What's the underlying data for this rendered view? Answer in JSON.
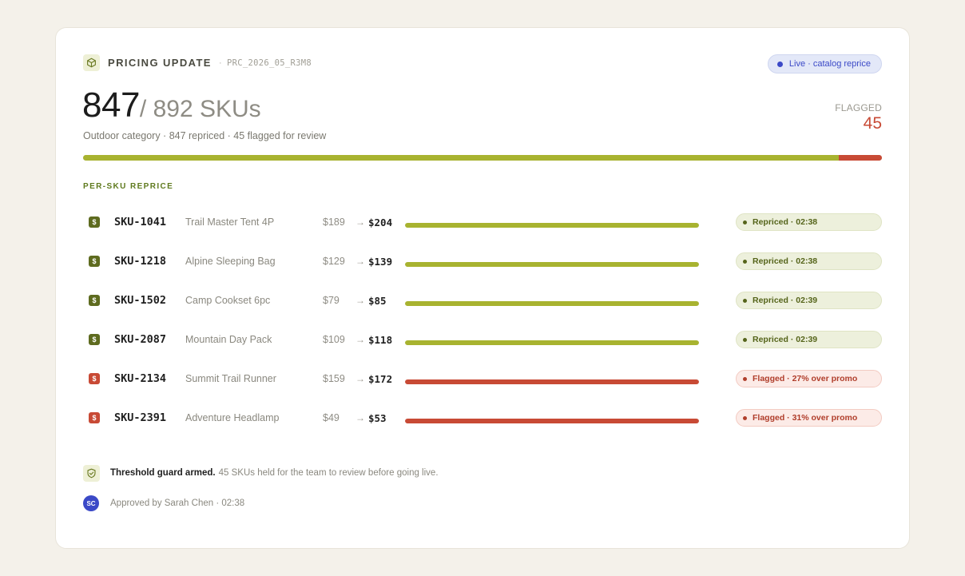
{
  "header": {
    "title": "PRICING UPDATE",
    "separator": "·",
    "run_code": "PRC_2026_05_R3M8",
    "live_label": "Live · catalog reprice"
  },
  "summary": {
    "repriced_count": "847",
    "total_label": "/ 892 SKUs",
    "subtitle": "Outdoor category · 847 repriced · 45 flagged for review",
    "flagged_label": "FLAGGED",
    "flagged_value": "45",
    "progress_repriced_fraction": 0.946
  },
  "section_title": "PER-SKU REPRICE",
  "colors": {
    "ok": "#a8b330",
    "flagged": "#c84a35",
    "live": "#3b49c7"
  },
  "rows": [
    {
      "sku": "SKU-1041",
      "name": "Trail Master Tent 4P",
      "old_price": "$189",
      "arrow": "→",
      "new_price": "$204",
      "status": "Repriced · 02:38",
      "state": "ok",
      "icon": "dollar-icon",
      "progress": 1.0
    },
    {
      "sku": "SKU-1218",
      "name": "Alpine Sleeping Bag",
      "old_price": "$129",
      "arrow": "→",
      "new_price": "$139",
      "status": "Repriced · 02:38",
      "state": "ok",
      "icon": "dollar-icon",
      "progress": 1.0
    },
    {
      "sku": "SKU-1502",
      "name": "Camp Cookset 6pc",
      "old_price": "$79",
      "arrow": "→",
      "new_price": "$85",
      "status": "Repriced · 02:39",
      "state": "ok",
      "icon": "dollar-icon",
      "progress": 1.0
    },
    {
      "sku": "SKU-2087",
      "name": "Mountain Day Pack",
      "old_price": "$109",
      "arrow": "→",
      "new_price": "$118",
      "status": "Repriced · 02:39",
      "state": "ok",
      "icon": "dollar-icon",
      "progress": 1.0
    },
    {
      "sku": "SKU-2134",
      "name": "Summit Trail Runner",
      "old_price": "$159",
      "arrow": "→",
      "new_price": "$172",
      "status": "Flagged · 27% over promo",
      "state": "bad",
      "icon": "dollar-icon",
      "progress": 1.0
    },
    {
      "sku": "SKU-2391",
      "name": "Adventure Headlamp",
      "old_price": "$49",
      "arrow": "→",
      "new_price": "$53",
      "status": "Flagged · 31% over promo",
      "state": "bad",
      "icon": "dollar-icon",
      "progress": 1.0
    }
  ],
  "footer": {
    "guard_bold": "Threshold guard armed.",
    "guard_text": "45 SKUs held for the team to review before going live.",
    "avatar_initials": "SC",
    "approved_text": "Approved by Sarah Chen · 02:38"
  }
}
